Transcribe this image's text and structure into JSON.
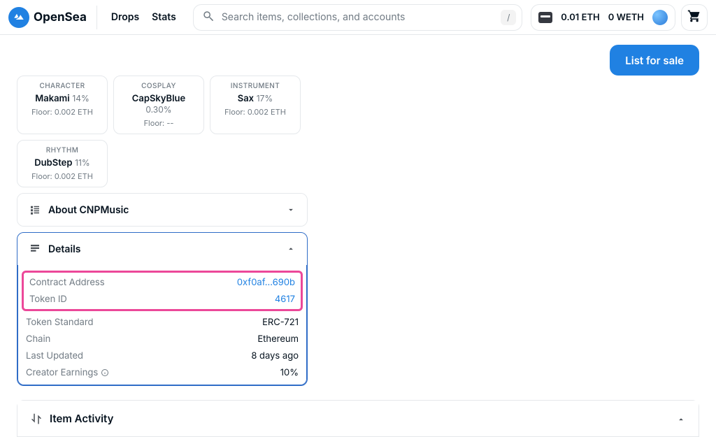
{
  "header": {
    "brand": "OpenSea",
    "nav": {
      "drops": "Drops",
      "stats": "Stats"
    },
    "search_placeholder": "Search items, collections, and accounts",
    "slash": "/",
    "wallet": {
      "eth": "0.01 ETH",
      "weth": "0 WETH"
    }
  },
  "action": {
    "list_label": "List for sale"
  },
  "traits": [
    {
      "label": "CHARACTER",
      "value": "Makami",
      "pct": "14%",
      "floor": "Floor: 0.002 ETH"
    },
    {
      "label": "COSPLAY",
      "value": "CapSkyBlue",
      "pct": "0.30%",
      "floor": "Floor: --"
    },
    {
      "label": "INSTRUMENT",
      "value": "Sax",
      "pct": "17%",
      "floor": "Floor: 0.002 ETH"
    },
    {
      "label": "RHYTHM",
      "value": "DubStep",
      "pct": "11%",
      "floor": "Floor: 0.002 ETH"
    }
  ],
  "about": {
    "title": "About CNPMusic"
  },
  "details": {
    "title": "Details",
    "contract_label": "Contract Address",
    "contract_value": "0xf0af...690b",
    "token_label": "Token ID",
    "token_value": "4617",
    "standard_label": "Token Standard",
    "standard_value": "ERC-721",
    "chain_label": "Chain",
    "chain_value": "Ethereum",
    "updated_label": "Last Updated",
    "updated_value": "8 days ago",
    "earnings_label": "Creator Earnings",
    "earnings_value": "10%"
  },
  "activity": {
    "title": "Item Activity"
  }
}
